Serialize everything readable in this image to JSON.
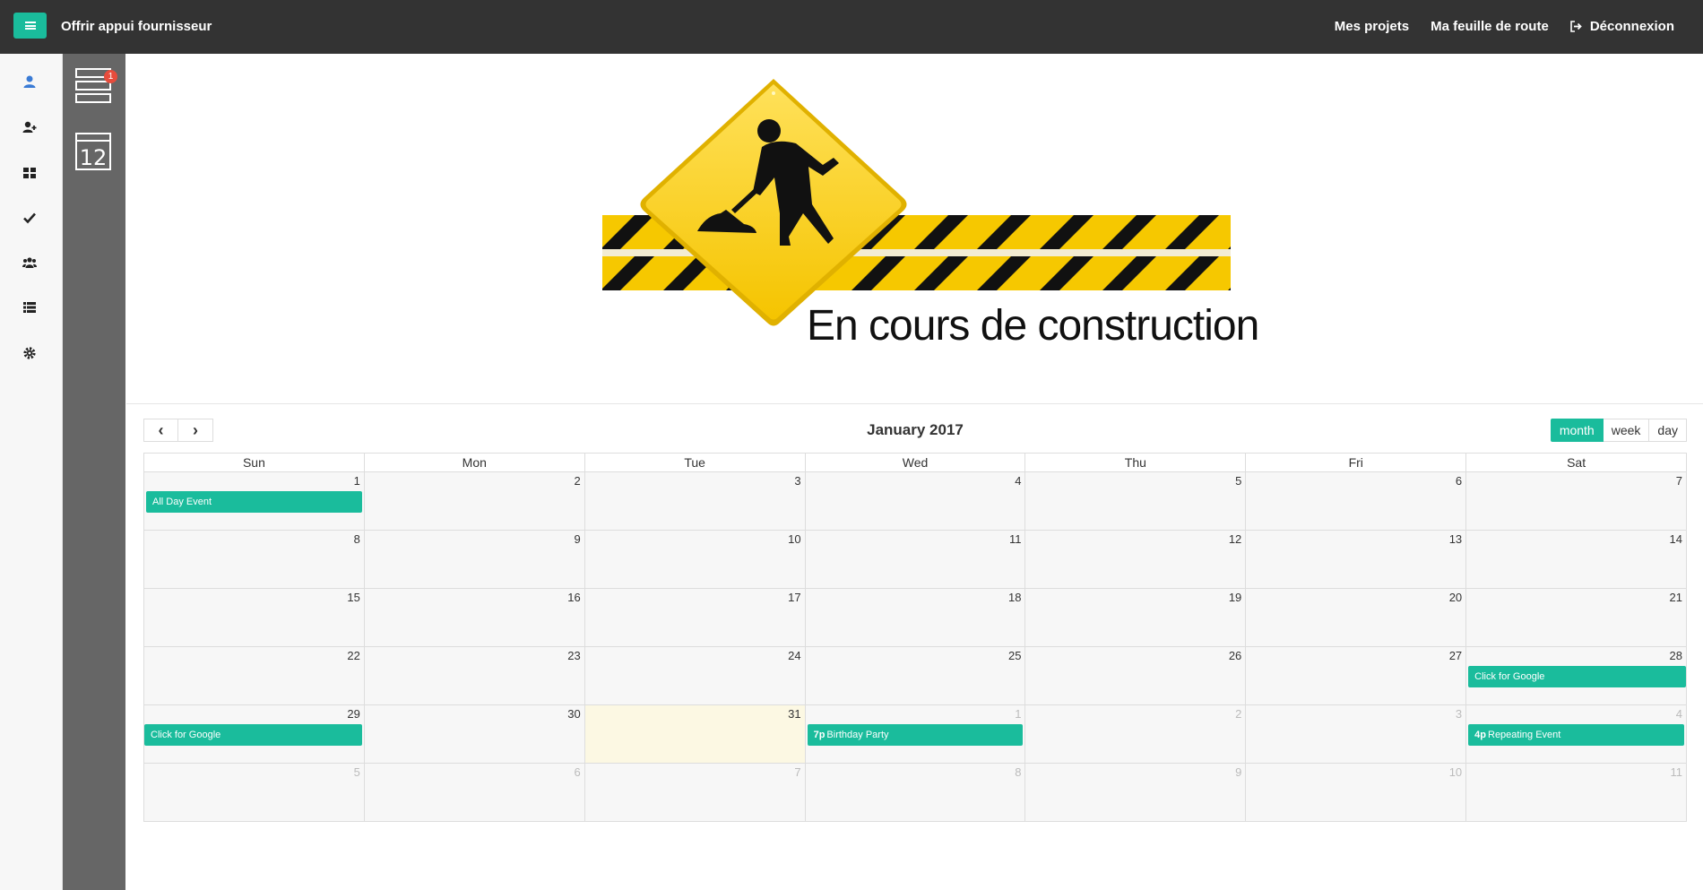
{
  "header": {
    "title": "Offrir appui fournisseur",
    "nav": [
      "Mes projets",
      "Ma feuille de route",
      "Déconnexion"
    ],
    "accent": "#1abc9c"
  },
  "sidebar": {
    "icons": [
      "user-icon",
      "user-plus-icon",
      "grid-icon",
      "check-icon",
      "users-icon",
      "list-icon",
      "gear-icon"
    ]
  },
  "subbar": {
    "badge": "1",
    "calendar_day": "12"
  },
  "banner": {
    "text": "En cours de construction"
  },
  "calendar": {
    "title": "January 2017",
    "prev": "‹",
    "next": "›",
    "views": [
      "month",
      "week",
      "day"
    ],
    "active_view": "month",
    "weekdays": [
      "Sun",
      "Mon",
      "Tue",
      "Wed",
      "Thu",
      "Fri",
      "Sat"
    ],
    "weeks": [
      [
        1,
        2,
        3,
        4,
        5,
        6,
        7
      ],
      [
        8,
        9,
        10,
        11,
        12,
        13,
        14
      ],
      [
        15,
        16,
        17,
        18,
        19,
        20,
        21
      ],
      [
        22,
        23,
        24,
        25,
        26,
        27,
        28
      ],
      [
        29,
        30,
        31,
        1,
        2,
        3,
        4
      ],
      [
        5,
        6,
        7,
        8,
        9,
        10,
        11
      ]
    ],
    "events": {
      "all_day": "All Day Event",
      "google_sat": "Click for Google",
      "google_sun": "Click for Google",
      "birthday_time": "7p",
      "birthday": "Birthday Party",
      "repeat_time": "4p",
      "repeat": "Repeating Event"
    }
  }
}
